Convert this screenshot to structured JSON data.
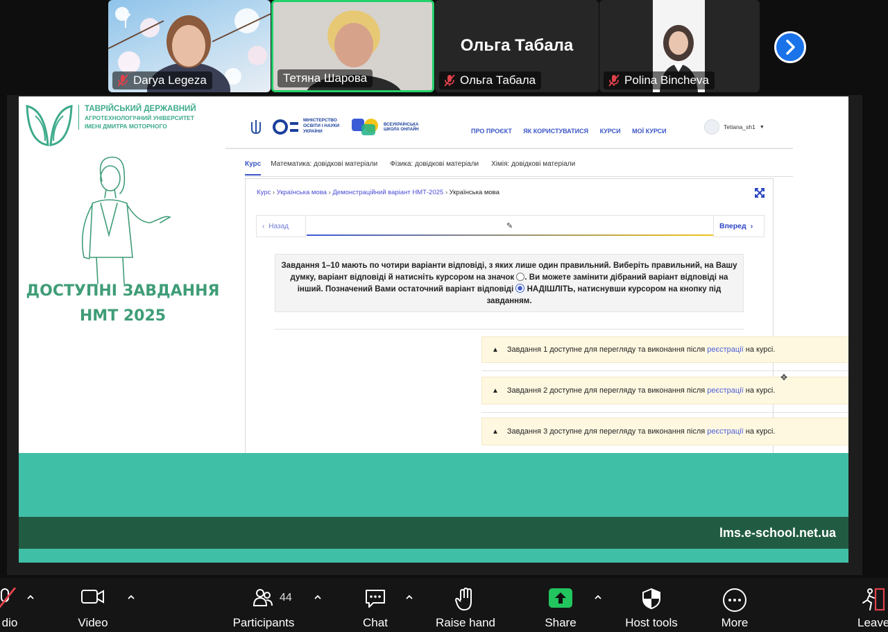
{
  "participants": [
    {
      "name": "Darya Legeza",
      "muted": true
    },
    {
      "name": "Тетяна Шарова",
      "muted": false
    },
    {
      "name": "Ольга Табала",
      "muted": true,
      "display_name": "Ольга Табала"
    },
    {
      "name": "Polina Bincheva",
      "muted": true
    }
  ],
  "slide": {
    "university": {
      "line1": "ТАВРІЙСЬКИЙ ДЕРЖАВНИЙ",
      "line2": "АГРОТЕХНОЛОГІЧНИЙ УНІВЕРСИТЕТ",
      "line3": "ІМЕНІ ДМИТРА МОТОРНОГО"
    },
    "title_line1": "ДОСТУПНІ ЗАВДАННЯ",
    "title_line2": "НМТ 2025",
    "footer_url": "lms.e-school.net.ua"
  },
  "site": {
    "ministry": {
      "l1": "МІНІСТЕРСТВО",
      "l2": "ОСВІТИ І НАУКИ",
      "l3": "УКРАЇНИ"
    },
    "school": {
      "l1": "ВСЕУКРАЇНСЬКА",
      "l2": "ШКОЛА ОНЛАЙН"
    },
    "nav": [
      "ПРО ПРОЄКТ",
      "ЯК КОРИСТУВАТИСЯ",
      "КУРСИ",
      "МОЇ КУРСИ"
    ],
    "user": "Tetiana_sh1",
    "tabs": [
      "Курс",
      "Математика: довідкові матеріали",
      "Фізика: довідкові матеріали",
      "Хімія: довідкові матеріали"
    ],
    "breadcrumb": {
      "c1": "Курс",
      "c2": "Українська мова",
      "c3": "Демонстраційний варіант НМТ-2025",
      "c4": "Українська мова"
    },
    "prev": "Назад",
    "next": "Вперед",
    "instructions": {
      "p1": "Завдання 1–10 мають по чотири варіанти відповіді, з яких лише один правильний. Виберіть правильний, на Вашу думку, варіант відповіді й натисніть курсором на значок",
      "p2": ". Ви можете замінити дібраний варіант відповіді на інший. Позначений Вами остаточний варіант відповіді",
      "p3": "НАДІШЛІТЬ, натиснувши курсором на кнопку під завданням."
    },
    "tasks": [
      {
        "before": "Завдання 1 доступне для перегляду та виконання після",
        "link": "реєстрації",
        "after": "на курсі."
      },
      {
        "before": "Завдання 2 доступне для перегляду та виконання після",
        "link": "реєстрації",
        "after": "на курсі."
      },
      {
        "before": "Завдання 3 доступне для перегляду та виконання після",
        "link": "реєстрації",
        "after": "на курсі."
      }
    ]
  },
  "toolbar": {
    "audio": "dio",
    "video": "Video",
    "participants": "Participants",
    "participants_count": "44",
    "chat": "Chat",
    "raise_hand": "Raise hand",
    "share": "Share",
    "host_tools": "Host tools",
    "more": "More",
    "leave": "Leave"
  },
  "colors": {
    "accent_green": "#3daa8b",
    "mint_band": "#40bfa7",
    "dark_band": "#215c42",
    "share_green": "#22c55e",
    "zoom_blue": "#1a73e8"
  }
}
